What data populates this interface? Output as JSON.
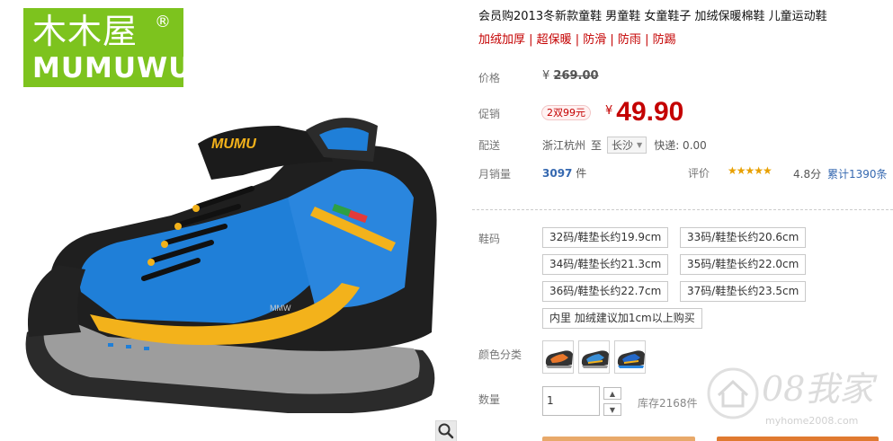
{
  "brand": {
    "logo_cn": "木木屋",
    "logo_en": "MUMUWU",
    "logo_reg": "®"
  },
  "product": {
    "title": "会员购2013冬新款童鞋 男童鞋 女童鞋子 加绒保暖棉鞋 儿童运动鞋",
    "subtitle": "加绒加厚 | 超保暖 | 防滑 | 防雨 | 防踢"
  },
  "price": {
    "label": "价格",
    "currency": "¥",
    "original": "269.00"
  },
  "promo": {
    "label": "促销",
    "tag": "2双99元",
    "currency": "¥",
    "price": "49.90"
  },
  "shipping": {
    "label": "配送",
    "origin": "浙江杭州",
    "to": "至",
    "destination": "长沙",
    "fee": "快递: 0.00"
  },
  "sales": {
    "label": "月销量",
    "count": "3097",
    "unit": "件"
  },
  "rating": {
    "label": "评价",
    "stars": "★★★★★",
    "score": "4.8分",
    "reviews": "累计1390条",
    "value": 4.8
  },
  "sizes": {
    "label": "鞋码",
    "items": [
      "32码/鞋垫长约19.9cm",
      "33码/鞋垫长约20.6cm",
      "34码/鞋垫长约21.3cm",
      "35码/鞋垫长约22.0cm",
      "36码/鞋垫长约22.7cm",
      "37码/鞋垫长约23.5cm",
      "内里 加绒建议加1cm以上购买"
    ]
  },
  "colors": {
    "label": "颜色分类",
    "items": [
      {
        "name": "orange-variant",
        "accent": "#e8762a"
      },
      {
        "name": "blue-variant",
        "accent": "#3a8fd6"
      },
      {
        "name": "navy-variant",
        "accent": "#2568c8"
      }
    ]
  },
  "quantity": {
    "label": "数量",
    "value": "1",
    "stock": "库存2168件"
  },
  "watermark": {
    "big": "08我家",
    "small": "myhome2008.com"
  },
  "theme": {
    "accent": "#c40000",
    "link": "#3568b0",
    "logo_green": "#7dc31e"
  }
}
